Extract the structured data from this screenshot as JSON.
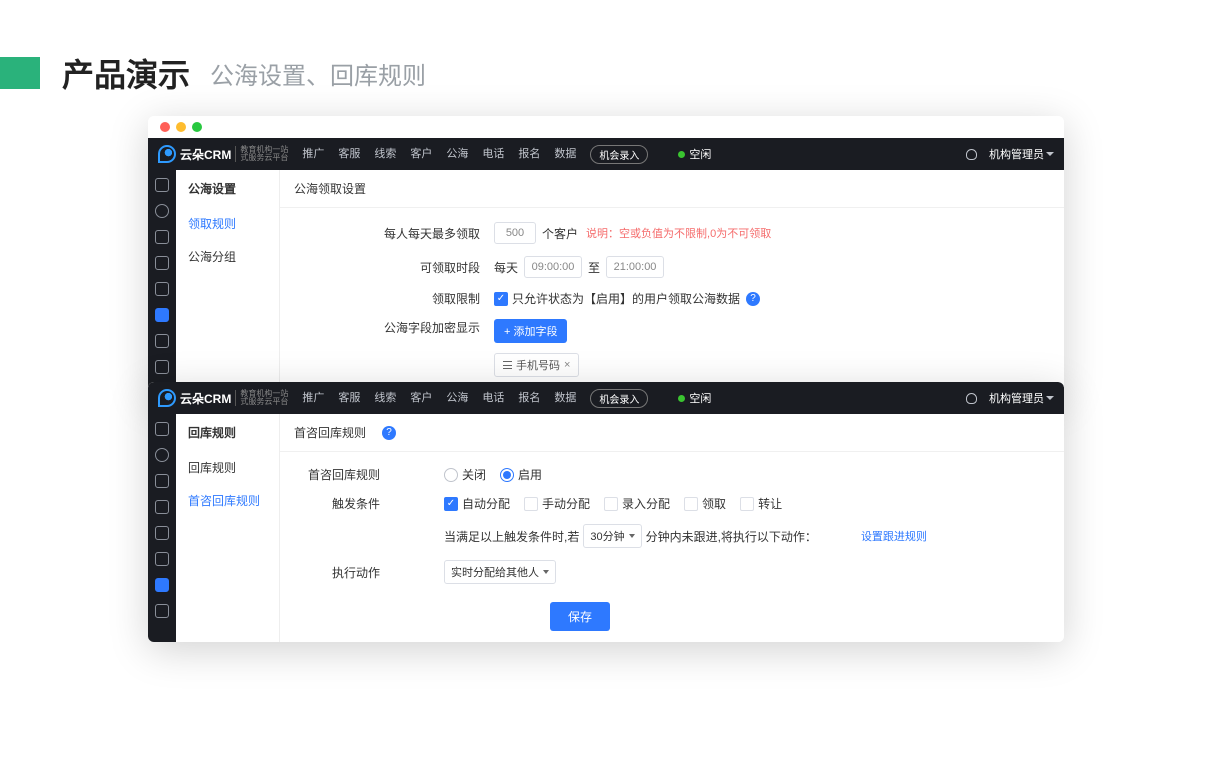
{
  "slide": {
    "title": "产品演示",
    "subtitle": "公海设置、回库规则"
  },
  "logo": {
    "name": "云朵CRM",
    "sub1": "教育机构一站",
    "sub2": "式服务云平台"
  },
  "nav": {
    "items": [
      "推广",
      "客服",
      "线索",
      "客户",
      "公海",
      "电话",
      "报名",
      "数据"
    ],
    "entry_btn": "机会录入",
    "status": "空闲",
    "user_role": "机构管理员"
  },
  "panel1": {
    "side_title": "公海设置",
    "side_items": [
      "领取规则",
      "公海分组"
    ],
    "content_title": "公海领取设置",
    "f1": {
      "label": "每人每天最多领取",
      "value": "500",
      "unit": "个客户",
      "note_prefix": "说明：",
      "note": "空或负值为不限制,0为不可领取"
    },
    "f2": {
      "label": "可领取时段",
      "prefix": "每天",
      "start": "09:00:00",
      "to": "至",
      "end": "21:00:00"
    },
    "f3": {
      "label": "领取限制",
      "text": "只允许状态为【启用】的用户领取公海数据"
    },
    "f4": {
      "label": "公海字段加密显示",
      "btn": "+ 添加字段",
      "tag": "手机号码"
    }
  },
  "panel2": {
    "side_title": "回库规则",
    "side_items": [
      "回库规则",
      "首咨回库规则"
    ],
    "content_title": "首咨回库规则",
    "f1": {
      "label": "首咨回库规则",
      "off": "关闭",
      "on": "启用"
    },
    "f2": {
      "label": "触发条件",
      "opts": [
        "自动分配",
        "手动分配",
        "录入分配",
        "领取",
        "转让"
      ]
    },
    "f3": {
      "prefix": "当满足以上触发条件时,若",
      "select": "30分钟",
      "mid": "分钟内未跟进,将执行以下动作：",
      "link": "设置跟进规则"
    },
    "f4": {
      "label": "执行动作",
      "select": "实时分配给其他人"
    },
    "save": "保存"
  }
}
